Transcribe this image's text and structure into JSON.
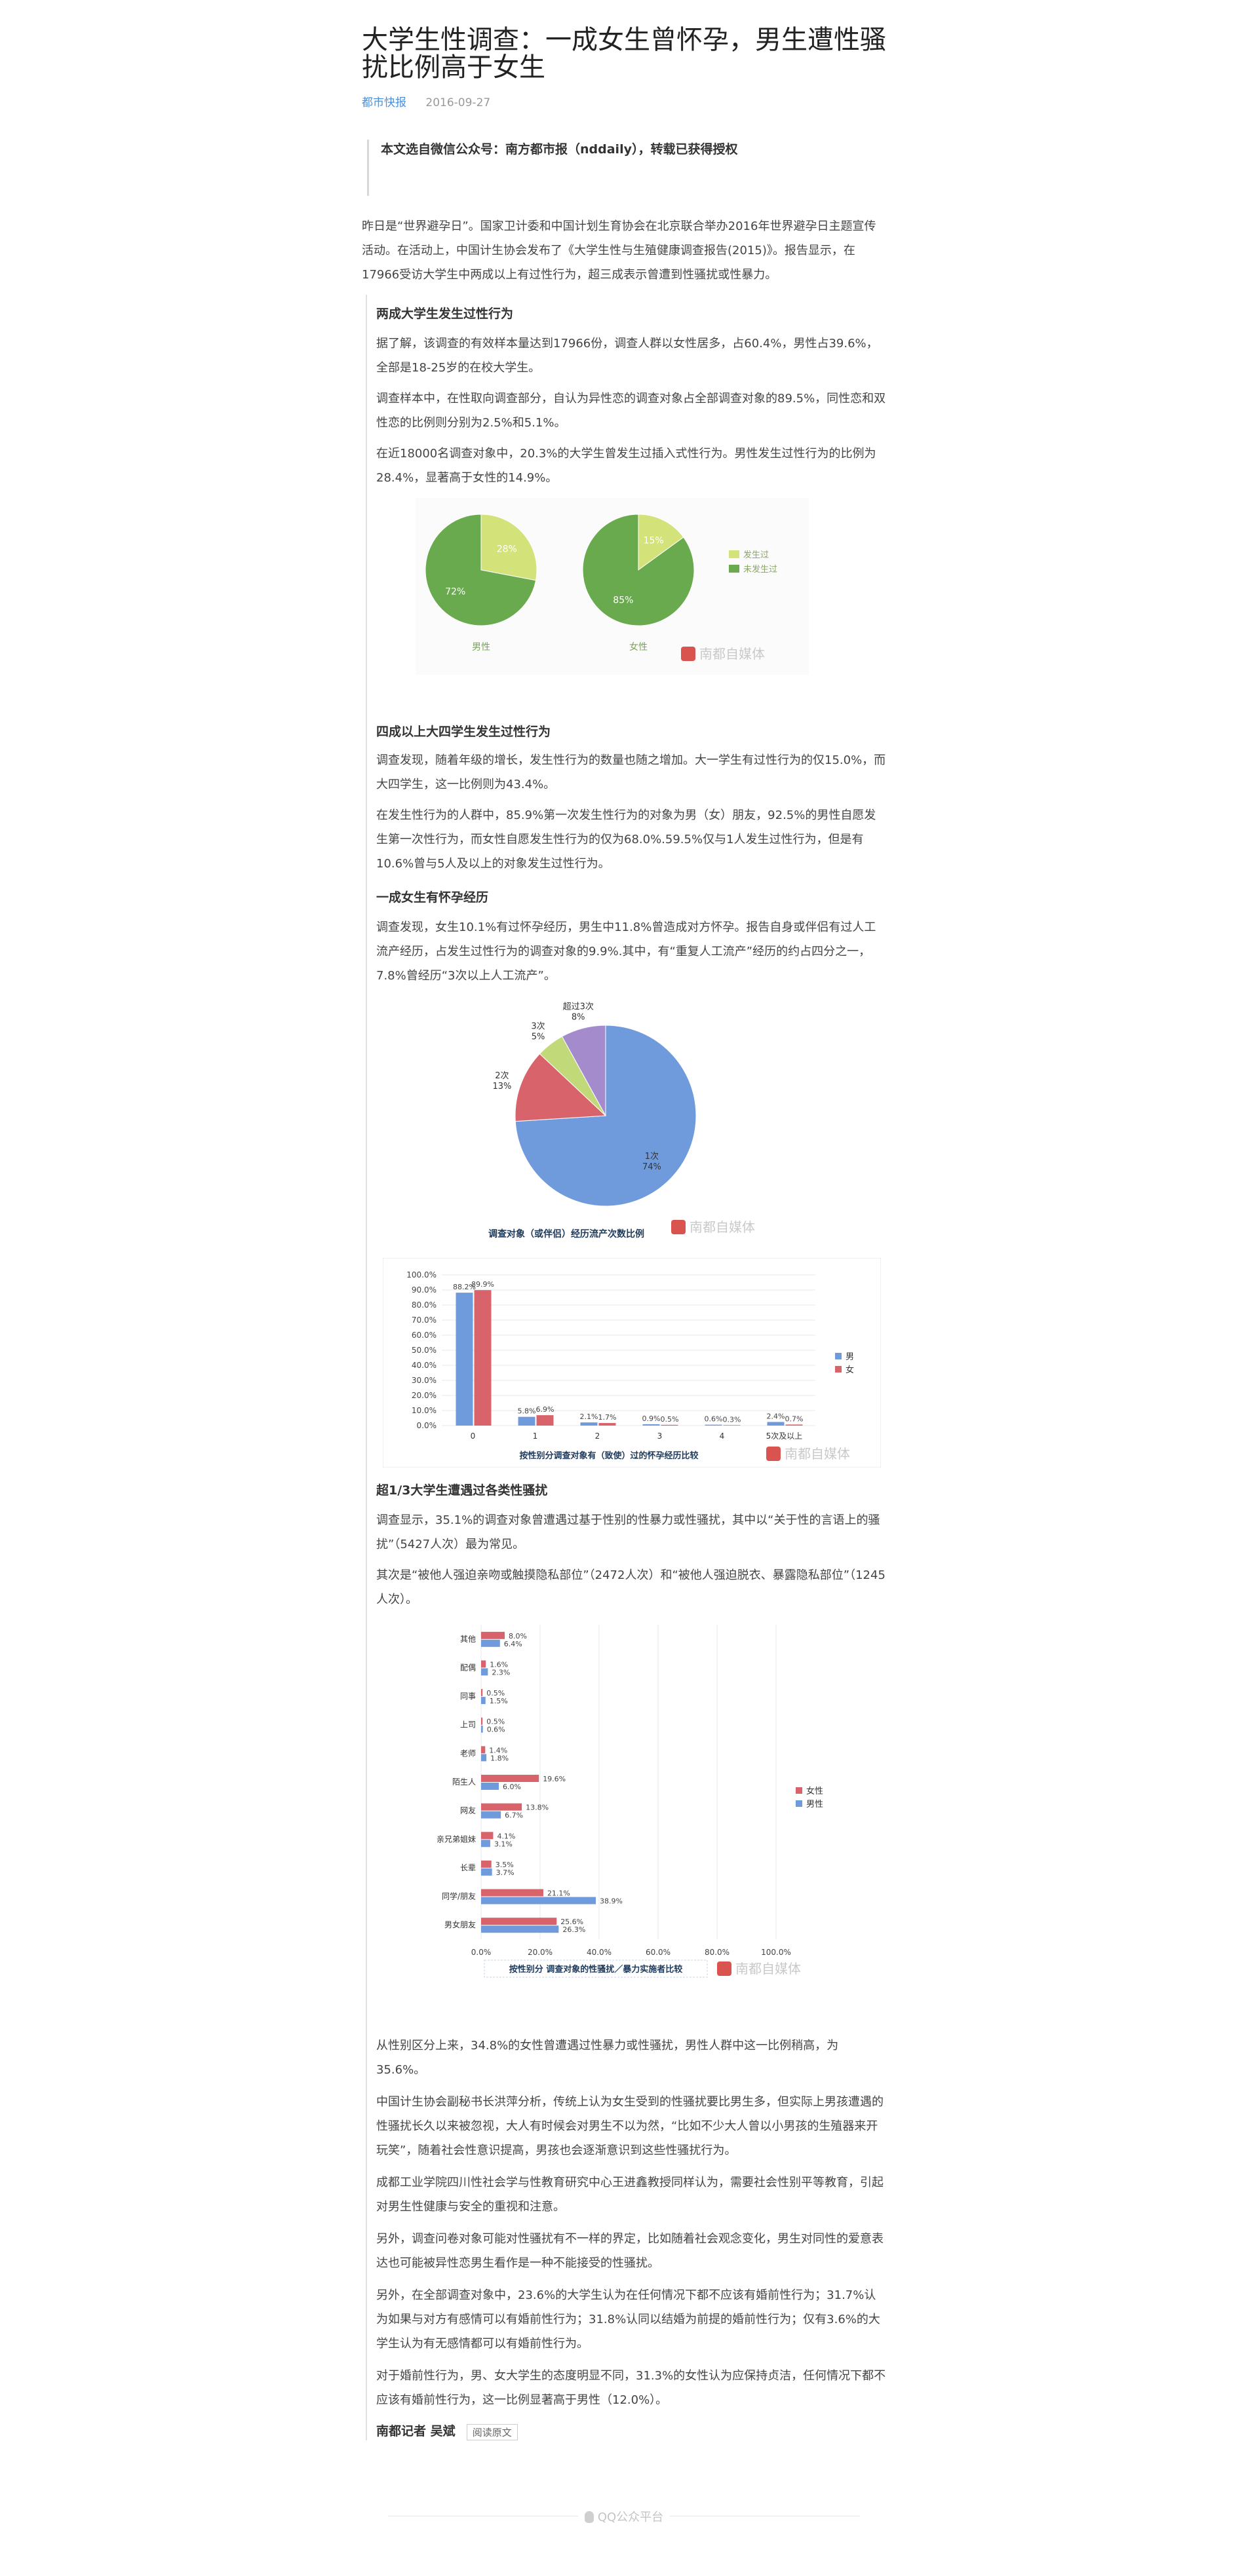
{
  "article": {
    "title": "大学生性调查：一成女生曾怀孕，男生遭性骚扰比例高于女生",
    "source": "都市快报",
    "date": "2016-09-27",
    "quote": "本文选自微信公众号：南方都市报（nddaily），转载已获得授权",
    "intro": "昨日是“世界避孕日”。国家卫计委和中国计划生育协会在北京联合举办2016年世界避孕日主题宣传活动。在活动上，中国计生协会发布了《大学生性与生殖健康调查报告(2015)》。报告显示，在17966受访大学生中两成以上有过性行为，超三成表示曾遭到性骚扰或性暴力。",
    "s1_heading": "两成大学生发生过性行为",
    "s1_p1": "据了解，该调查的有效样本量达到17966份，调查人群以女性居多，占60.4%，男性占39.6%，全部是18-25岁的在校大学生。",
    "s1_p2": "调查样本中，在性取向调查部分，自认为异性恋的调查对象占全部调查对象的89.5%，同性恋和双性恋的比例则分别为2.5%和5.1%。",
    "s1_p3": "在近18000名调查对象中，20.3%的大学生曾发生过插入式性行为。男性发生过性行为的比例为28.4%，显著高于女性的14.9%。",
    "s2_heading": "四成以上大四学生发生过性行为",
    "s2_p1": "调查发现，随着年级的增长，发生性行为的数量也随之增加。大一学生有过性行为的仅15.0%，而大四学生，这一比例则为43.4%。",
    "s2_p2": "在发生性行为的人群中，85.9%第一次发生性行为的对象为男（女）朋友，92.5%的男性自愿发生第一次性行为，而女性自愿发生性行为的仅为68.0%.59.5%仅与1人发生过性行为，但是有10.6%曾与5人及以上的对象发生过性行为。",
    "s3_heading": "一成女生有怀孕经历",
    "s3_p1": "调查发现，女生10.1%有过怀孕经历，男生中11.8%曾造成对方怀孕。报告自身或伴侣有过人工流产经历，占发生过性行为的调查对象的9.9%.其中，有“重复人工流产”经历的约占四分之一，7.8%曾经历“3次以上人工流产”。",
    "s4_heading": "超1/3大学生遭遇过各类性骚扰",
    "s4_p1": "调查显示，35.1%的调查对象曾遭遇过基于性别的性暴力或性骚扰，其中以“关于性的言语上的骚扰”（5427人次）最为常见。",
    "s4_p2": "其次是“被他人强迫亲吻或触摸隐私部位”（2472人次）和“被他人强迫脱衣、暴露隐私部位”（1245人次）。",
    "s5_p1": "从性别区分上来，34.8%的女性曾遭遇过性暴力或性骚扰，男性人群中这一比例稍高，为35.6%。",
    "s5_p2": "中国计生协会副秘书长洪萍分析，传统上认为女生受到的性骚扰要比男生多，但实际上男孩遭遇的性骚扰长久以来被忽视，大人有时候会对男生不以为然，“比如不少大人曾以小男孩的生殖器来开玩笑”，随着社会性意识提高，男孩也会逐渐意识到这些性骚扰行为。",
    "s5_p3": "成都工业学院四川性社会学与性教育研究中心王进鑫教授同样认为，需要社会性别平等教育，引起对男生性健康与安全的重视和注意。",
    "s5_p4": "另外，调查问卷对象可能对性骚扰有不一样的界定，比如随着社会观念变化，男生对同性的爱意表达也可能被异性恋男生看作是一种不能接受的性骚扰。",
    "s5_p5": "另外，在全部调查对象中，23.6%的大学生认为在任何情况下都不应该有婚前性行为；31.7%认为如果与对方有感情可以有婚前性行为；31.8%认同以结婚为前提的婚前性行为；仅有3.6%的大学生认为有无感情都可以有婚前性行为。",
    "s5_p6": "对于婚前性行为，男、女大学生的态度明显不同，31.3%的女性认为应保持贞洁，任何情况下都不应该有婚前性行为，这一比例显著高于男性（12.0%）。",
    "author": "南都记者 吴斌",
    "read_more": "阅读原文",
    "platform": "QQ公众平台"
  },
  "watermark": "南都自媒体",
  "chart_data": [
    {
      "type": "pie",
      "panels": [
        {
          "label": "男性",
          "values": [
            28,
            72
          ]
        },
        {
          "label": "女性",
          "values": [
            15,
            85
          ]
        }
      ],
      "categories": [
        "发生过",
        "未发生过"
      ],
      "colors": [
        "#d4e27a",
        "#6aaa4e"
      ],
      "data_labels": [
        [
          "28%",
          "72%"
        ],
        [
          "15%",
          "85%"
        ]
      ],
      "legend": "right"
    },
    {
      "type": "pie",
      "title": "调查对象（或伴侣）经历流产次数比例",
      "categories": [
        "1次",
        "2次",
        "3次",
        "超过3次"
      ],
      "values": [
        74,
        13,
        5,
        8
      ],
      "colors": [
        "#6f9bdc",
        "#d8636a",
        "#c2d97a",
        "#a48ccc"
      ],
      "data_labels": [
        [
          "1次",
          "74%"
        ],
        [
          "2次",
          "13%"
        ],
        [
          "3次",
          "5%"
        ],
        [
          "超过3次",
          "8%"
        ]
      ]
    },
    {
      "type": "bar",
      "title": "按性别分调查对象有（致使）过的怀孕经历比较",
      "categories": [
        "0",
        "1",
        "2",
        "3",
        "4",
        "5次及以上"
      ],
      "series": [
        {
          "name": "男",
          "values": [
            88.2,
            5.8,
            2.1,
            0.9,
            0.6,
            2.4
          ],
          "labels": [
            "88.2%",
            "5.8%",
            "2.1%",
            "0.9%",
            "0.6%",
            "2.4%"
          ],
          "color": "#6f9bdc"
        },
        {
          "name": "女",
          "values": [
            89.9,
            6.9,
            1.7,
            0.5,
            0.3,
            0.7
          ],
          "labels": [
            "89.9%",
            "6.9%",
            "1.7%",
            "0.5%",
            "0.3%",
            "0.7%"
          ],
          "color": "#d8636a"
        }
      ],
      "yticks": [
        "100.0%",
        "90.0%",
        "80.0%",
        "70.0%",
        "60.0%",
        "50.0%",
        "40.0%",
        "30.0%",
        "20.0%",
        "10.0%",
        "0.0%"
      ],
      "ylim": [
        0,
        100
      ],
      "legend": "right"
    },
    {
      "type": "bar",
      "orientation": "horizontal",
      "title": "按性别分 调查对象的性骚扰／暴力实施者比较",
      "categories": [
        "其他",
        "配偶",
        "同事",
        "上司",
        "老师",
        "陌生人",
        "网友",
        "亲兄弟姐妹",
        "长辈",
        "同学/朋友",
        "男女朋友"
      ],
      "series": [
        {
          "name": "女性",
          "values": [
            8.0,
            1.6,
            0.5,
            0.5,
            1.4,
            19.6,
            13.8,
            4.1,
            3.5,
            21.1,
            25.6
          ],
          "labels": [
            "8.0%",
            "1.6%",
            "0.5%",
            "0.5%",
            "1.4%",
            "19.6%",
            "13.8%",
            "4.1%",
            "3.5%",
            "21.1%",
            "25.6%"
          ],
          "color": "#d8636a"
        },
        {
          "name": "男性",
          "values": [
            6.4,
            2.3,
            1.5,
            0.6,
            1.8,
            6.0,
            6.7,
            3.1,
            3.7,
            38.9,
            26.3
          ],
          "labels": [
            "6.4%",
            "2.3%",
            "1.5%",
            "0.6%",
            "1.8%",
            "6.0%",
            "6.7%",
            "3.1%",
            "3.7%",
            "38.9%",
            "26.3%"
          ],
          "color": "#6f9bdc"
        }
      ],
      "xticks": [
        "0.0%",
        "20.0%",
        "40.0%",
        "60.0%",
        "80.0%",
        "100.0%"
      ],
      "xlim": [
        0,
        100
      ],
      "legend": "right"
    }
  ]
}
